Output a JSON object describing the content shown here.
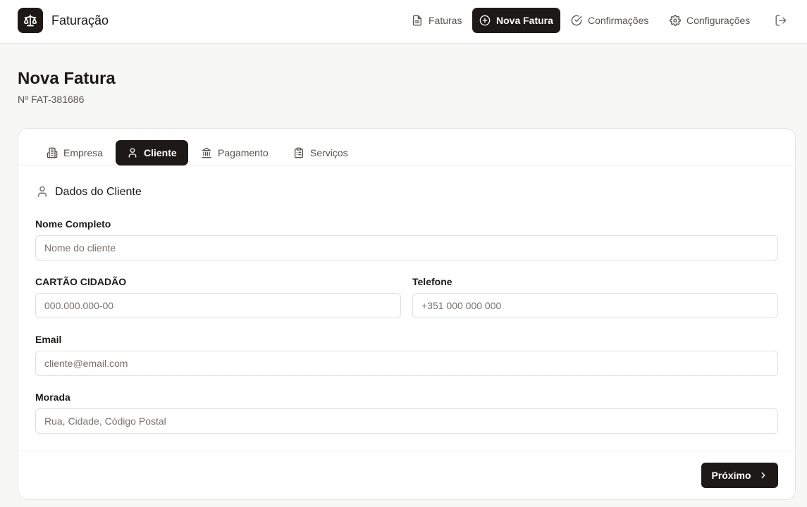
{
  "app": {
    "title": "Faturação"
  },
  "nav": {
    "invoices_label": "Faturas",
    "new_invoice_label": "Nova Fatura",
    "confirmations_label": "Confirmações",
    "settings_label": "Configurações"
  },
  "page": {
    "title": "Nova Fatura",
    "invoice_number": "Nº FAT-381686"
  },
  "tabs": [
    {
      "label": "Empresa",
      "icon": "building-icon",
      "active": false
    },
    {
      "label": "Cliente",
      "icon": "user-icon",
      "active": true
    },
    {
      "label": "Pagamento",
      "icon": "bank-icon",
      "active": false
    },
    {
      "label": "Serviços",
      "icon": "clipboard-icon",
      "active": false
    }
  ],
  "section": {
    "title": "Dados do Cliente",
    "icon": "user-icon"
  },
  "form": {
    "full_name": {
      "label": "Nome Completo",
      "placeholder": "Nome do cliente",
      "value": ""
    },
    "citizen_card": {
      "label": "CARTÃO CIDADÃO",
      "placeholder": "000.000.000-00",
      "value": ""
    },
    "phone": {
      "label": "Telefone",
      "placeholder": "+351 000 000 000",
      "value": ""
    },
    "email": {
      "label": "Email",
      "placeholder": "cliente@email.com",
      "value": ""
    },
    "address": {
      "label": "Morada",
      "placeholder": "Rua, Cidade, Código Postal",
      "value": ""
    }
  },
  "actions": {
    "next_label": "Próximo"
  },
  "colors": {
    "primary": "#1c1917",
    "background": "#f7f7f6",
    "surface": "#ffffff",
    "muted_text": "#57534e",
    "border": "#e2e0de"
  }
}
